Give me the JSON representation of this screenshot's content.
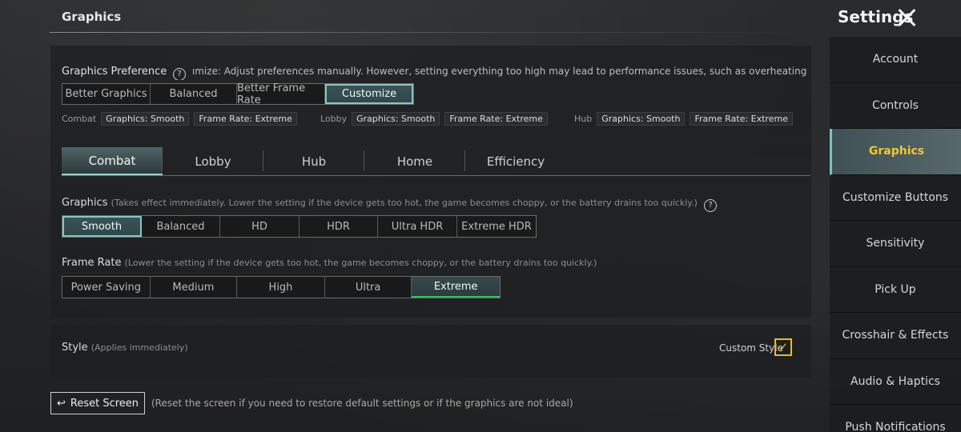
{
  "page_title": "Graphics",
  "header": {
    "settings_title": "Settings"
  },
  "preference": {
    "label": "Graphics Preference",
    "help": "?",
    "hint": "ımize: Adjust preferences manually. However, setting everything too high may lead to performance issues, such as overheating, battery drain, or choppy game",
    "options": [
      "Better Graphics",
      "Balanced",
      "Better Frame Rate",
      "Customize"
    ],
    "selected": "Customize"
  },
  "summary": [
    {
      "mode": "Combat",
      "graphics": "Graphics: Smooth",
      "frame_rate": "Frame Rate: Extreme"
    },
    {
      "mode": "Lobby",
      "graphics": "Graphics: Smooth",
      "frame_rate": "Frame Rate: Extreme"
    },
    {
      "mode": "Hub",
      "graphics": "Graphics: Smooth",
      "frame_rate": "Frame Rate: Extreme"
    }
  ],
  "tabs": [
    "Combat",
    "Lobby",
    "Hub",
    "Home",
    "Efficiency"
  ],
  "active_tab": "Combat",
  "graphics": {
    "label": "Graphics",
    "hint": "(Takes effect immediately. Lower the setting if the device gets too hot, the game becomes choppy, or the battery drains too quickly.)",
    "help": "?",
    "options": [
      "Smooth",
      "Balanced",
      "HD",
      "HDR",
      "Ultra HDR",
      "Extreme HDR"
    ],
    "selected": "Smooth"
  },
  "frame_rate": {
    "label": "Frame Rate",
    "hint": "(Lower the setting if the device gets too hot, the game becomes choppy, or the battery drains too quickly.)",
    "options": [
      "Power Saving",
      "Medium",
      "High",
      "Ultra",
      "Extreme"
    ],
    "selected": "Extreme"
  },
  "style": {
    "label": "Style",
    "hint": "(Applies immediately)",
    "custom_style_label": "Custom Style",
    "custom_style_checked": true,
    "check_glyph": "✓"
  },
  "reset": {
    "glyph": "↩",
    "label": "Reset Screen",
    "hint": "(Reset the screen if you need to restore default settings or if the graphics are not ideal)"
  },
  "sidebar": {
    "items": [
      "Account",
      "Controls",
      "Graphics",
      "Customize Buttons",
      "Sensitivity",
      "Pick Up",
      "Crosshair & Effects",
      "Audio & Haptics",
      "Push Notifications"
    ],
    "active": "Graphics"
  },
  "colors": {
    "accent_teal": "#8bc4c6",
    "accent_yellow": "#f5c633",
    "checkbox": "#e1b93a",
    "selected_green": "#45b86a"
  }
}
